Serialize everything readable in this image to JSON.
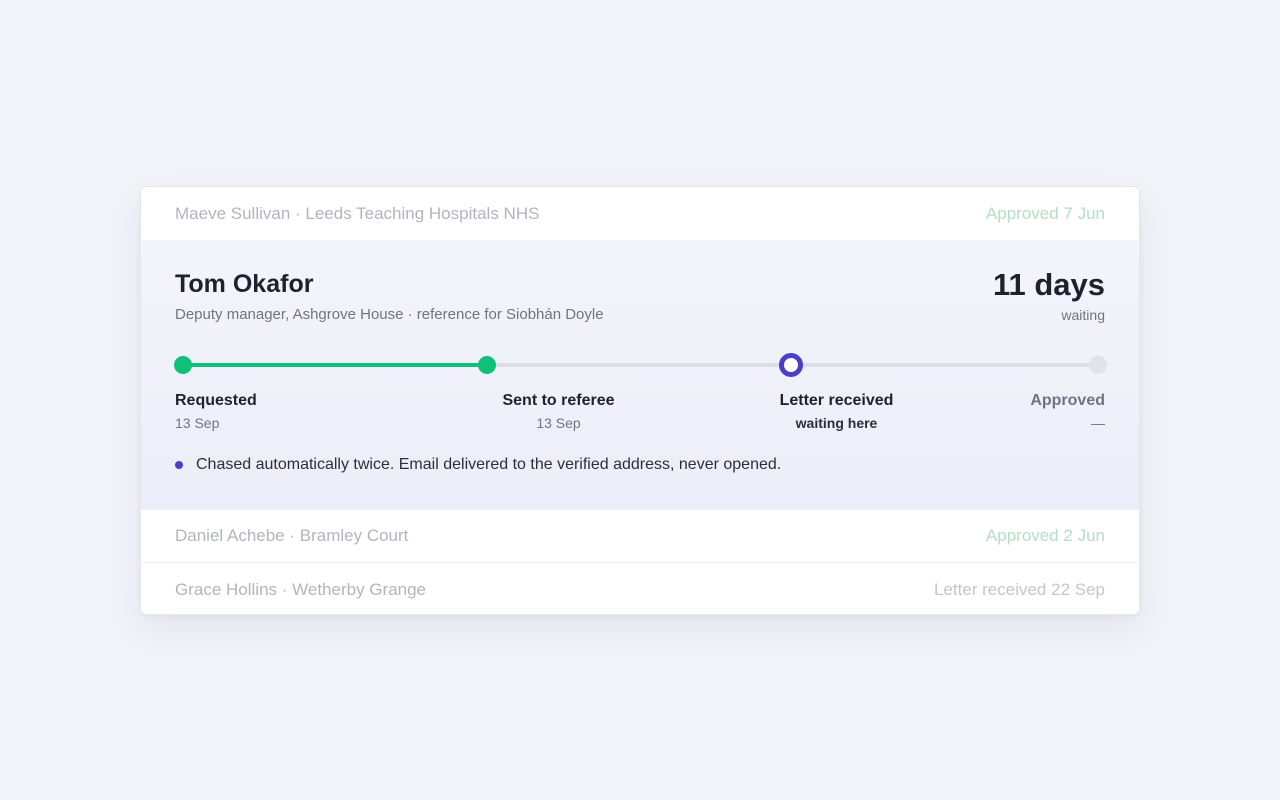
{
  "rows": [
    {
      "left": "Maeve Sullivan · Leeds Teaching Hospitals NHS",
      "right": "Approved 7 Jun"
    },
    {
      "left": "Daniel Achebe · Bramley Court",
      "right": "Approved 2 Jun"
    },
    {
      "left": "Grace Hollins · Wetherby Grange",
      "right": "Letter received 22 Sep"
    }
  ],
  "expanded": {
    "name": "Tom Okafor",
    "subtitle": "Deputy manager, Ashgrove House · reference for Siobhán Doyle",
    "days": "11 days",
    "days_label": "waiting",
    "progress_fraction": 0.33,
    "steps": [
      {
        "label": "Requested",
        "date": "13 Sep",
        "state": "done"
      },
      {
        "label": "Sent to referee",
        "date": "13 Sep",
        "state": "done"
      },
      {
        "label": "Letter received",
        "date": "waiting here",
        "state": "current"
      },
      {
        "label": "Approved",
        "date": "—",
        "state": "pending"
      }
    ],
    "note": "Chased automatically twice. Email delivered to the verified address, never opened."
  },
  "colors": {
    "done": "#10c07a",
    "current": "#4a3fc9",
    "pending": "#e1e2ea"
  }
}
